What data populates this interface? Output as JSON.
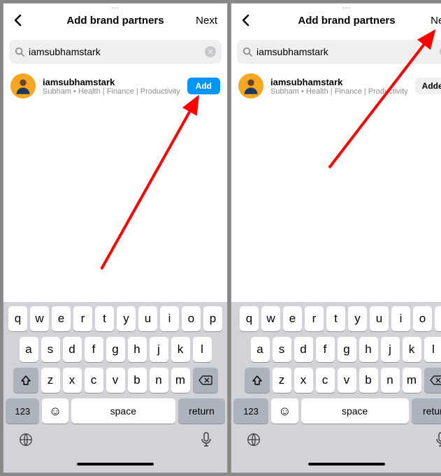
{
  "screens": [
    {
      "title": "Add brand partners",
      "next": "Next",
      "search": {
        "value": "iamsubhamstark"
      },
      "result": {
        "username": "iamsubhamstark",
        "subtitle": "Subham • Health | Finance | Productivity",
        "action_label": "Add",
        "action_state": "add"
      }
    },
    {
      "title": "Add brand partners",
      "next": "Next",
      "search": {
        "value": "iamsubhamstark"
      },
      "result": {
        "username": "iamsubhamstark",
        "subtitle": "Subham • Health | Finance | Productivity",
        "action_label": "Added",
        "action_state": "added"
      }
    }
  ],
  "keyboard": {
    "row1": [
      "q",
      "w",
      "e",
      "r",
      "t",
      "y",
      "u",
      "i",
      "o",
      "p"
    ],
    "row2": [
      "a",
      "s",
      "d",
      "f",
      "g",
      "h",
      "j",
      "k",
      "l"
    ],
    "row3": [
      "z",
      "x",
      "c",
      "v",
      "b",
      "n",
      "m"
    ],
    "num": "123",
    "space": "space",
    "return": "return"
  }
}
